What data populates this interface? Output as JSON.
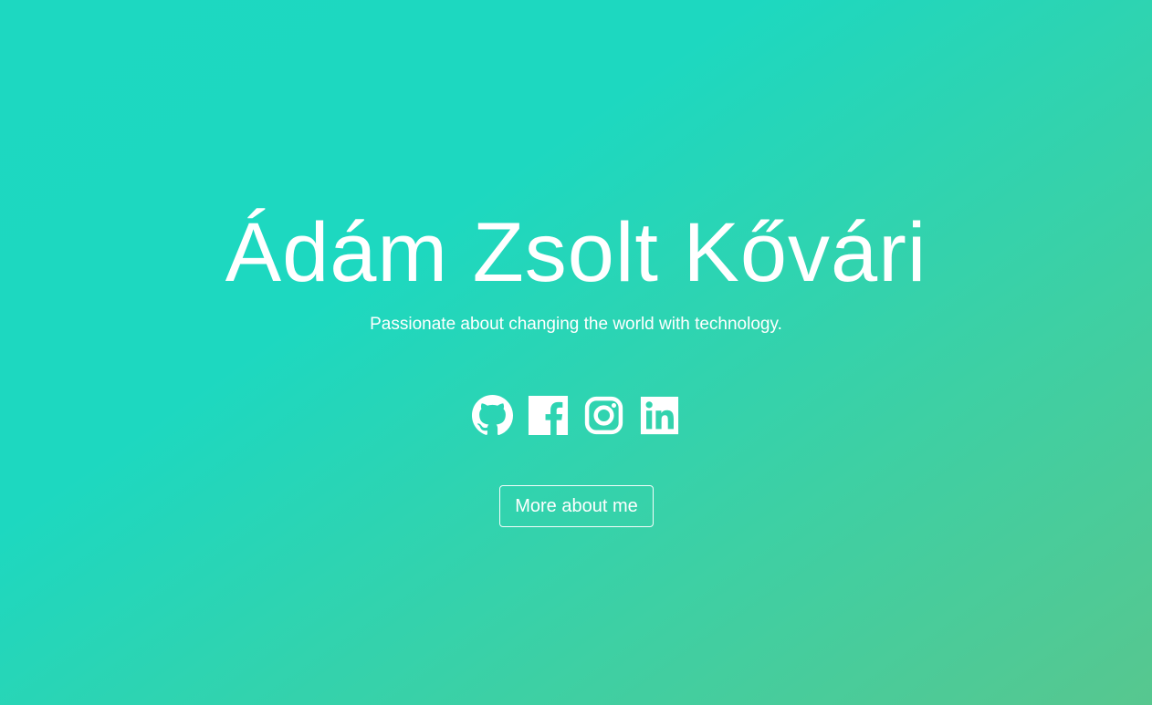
{
  "hero": {
    "title": "Ádám Zsolt Kővári",
    "subtitle": "Passionate about changing the world with technology.",
    "more_button_label": "More about me"
  },
  "socials": [
    {
      "name": "github",
      "icon": "github-icon"
    },
    {
      "name": "facebook",
      "icon": "facebook-icon"
    },
    {
      "name": "instagram",
      "icon": "instagram-icon"
    },
    {
      "name": "linkedin",
      "icon": "linkedin-icon"
    }
  ],
  "colors": {
    "gradient_start": "#1dd8c1",
    "gradient_end": "#57c78f",
    "text": "#ffffff"
  }
}
